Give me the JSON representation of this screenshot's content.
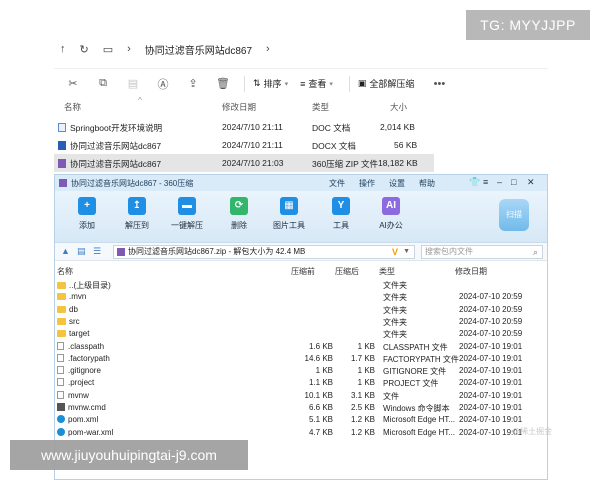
{
  "watermark_top": "TG: MYYJJPP",
  "watermark_bottom": "www.jiuyouhuipingtai-j9.com",
  "watermark_faint": "@稀土掘金",
  "explorer": {
    "path": "协同过滤音乐网站dc867",
    "toolbar": {
      "sort_label": "排序",
      "view_label": "查看",
      "extract_label": "全部解压缩"
    },
    "headers": {
      "name": "名称",
      "date": "修改日期",
      "type": "类型",
      "size": "大小"
    },
    "files": [
      {
        "name": "Springboot开发环境说明",
        "date": "2024/7/10 21:11",
        "type": "DOC 文档",
        "size": "2,014 KB",
        "icon": "doc"
      },
      {
        "name": "协同过滤音乐网站dc867",
        "date": "2024/7/10 21:11",
        "type": "DOCX 文档",
        "size": "56 KB",
        "icon": "word"
      },
      {
        "name": "协同过滤音乐网站dc867",
        "date": "2024/7/10 21:03",
        "type": "360压缩 ZIP 文件",
        "size": "18,182 KB",
        "icon": "zip"
      }
    ]
  },
  "zipwin": {
    "title": "协同过滤音乐网站dc867 - 360压缩",
    "menu": [
      "文件",
      "操作",
      "设置",
      "帮助"
    ],
    "ribbon": [
      "添加",
      "解压到",
      "一键解压",
      "删除",
      "图片工具",
      "工具",
      "AI办公"
    ],
    "scan_label": "扫描",
    "path_text": "协同过滤音乐网站dc867.zip - 解包大小为 42.4 MB",
    "search_placeholder": "搜索包内文件",
    "headers": {
      "name": "名称",
      "packed": "压缩前",
      "unpacked": "压缩后",
      "type": "类型",
      "date": "修改日期"
    },
    "rows": [
      {
        "name": "..(上级目录)",
        "packed": "",
        "unpacked": "",
        "type": "文件夹",
        "date": "",
        "icon": "folder"
      },
      {
        "name": ".mvn",
        "packed": "",
        "unpacked": "",
        "type": "文件夹",
        "date": "2024-07-10 20:59",
        "icon": "folder"
      },
      {
        "name": "db",
        "packed": "",
        "unpacked": "",
        "type": "文件夹",
        "date": "2024-07-10 20:59",
        "icon": "folder"
      },
      {
        "name": "src",
        "packed": "",
        "unpacked": "",
        "type": "文件夹",
        "date": "2024-07-10 20:59",
        "icon": "folder"
      },
      {
        "name": "target",
        "packed": "",
        "unpacked": "",
        "type": "文件夹",
        "date": "2024-07-10 20:59",
        "icon": "folder"
      },
      {
        "name": ".classpath",
        "packed": "1.6 KB",
        "unpacked": "1 KB",
        "type": "CLASSPATH 文件",
        "date": "2024-07-10 19:01",
        "icon": "doc"
      },
      {
        "name": ".factorypath",
        "packed": "14.6 KB",
        "unpacked": "1.7 KB",
        "type": "FACTORYPATH 文件",
        "date": "2024-07-10 19:01",
        "icon": "doc"
      },
      {
        "name": ".gitignore",
        "packed": "1 KB",
        "unpacked": "1 KB",
        "type": "GITIGNORE 文件",
        "date": "2024-07-10 19:01",
        "icon": "doc"
      },
      {
        "name": ".project",
        "packed": "1.1 KB",
        "unpacked": "1 KB",
        "type": "PROJECT 文件",
        "date": "2024-07-10 19:01",
        "icon": "doc"
      },
      {
        "name": "mvnw",
        "packed": "10.1 KB",
        "unpacked": "3.1 KB",
        "type": "文件",
        "date": "2024-07-10 19:01",
        "icon": "doc"
      },
      {
        "name": "mvnw.cmd",
        "packed": "6.6 KB",
        "unpacked": "2.5 KB",
        "type": "Windows 命令脚本",
        "date": "2024-07-10 19:01",
        "icon": "cmd"
      },
      {
        "name": "pom.xml",
        "packed": "5.1 KB",
        "unpacked": "1.2 KB",
        "type": "Microsoft Edge HT...",
        "date": "2024-07-10 19:01",
        "icon": "edge"
      },
      {
        "name": "pom-war.xml",
        "packed": "4.7 KB",
        "unpacked": "1.2 KB",
        "type": "Microsoft Edge HT...",
        "date": "2024-07-10 19:01",
        "icon": "edge"
      }
    ]
  }
}
